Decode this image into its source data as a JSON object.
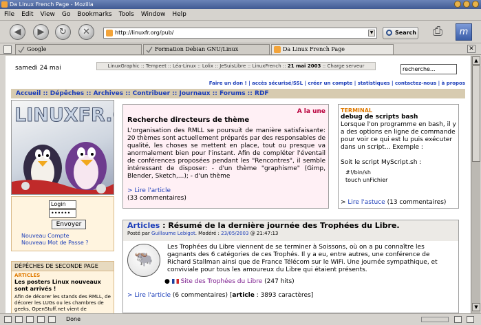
{
  "window": {
    "title": "Da Linux French Page - Mozilla"
  },
  "menu": [
    "File",
    "Edit",
    "View",
    "Go",
    "Bookmarks",
    "Tools",
    "Window",
    "Help"
  ],
  "toolbar": {
    "url": "http://linuxfr.org/pub/",
    "search_label": "Search"
  },
  "tabs": [
    {
      "label": "Google"
    },
    {
      "label": "Formation Debian GNU/Linux"
    },
    {
      "label": "Da Linux French Page"
    }
  ],
  "status": {
    "text": "Done"
  },
  "page": {
    "date": "samedi 24 mai",
    "sites_bar": {
      "before": "LinuxGraphic :: Tempeet :: Léa-Linux :: Lolix :: JeSuisLibre :: LinuxFrench :: ",
      "date": "21 mai 2003",
      "after": " :: Charge serveur"
    },
    "search_value": "recherche...",
    "top_links": "Faire un don ! | accès sécurisé/SSL | créer un compte | statistiques | contactez-nous | à propos",
    "nav": "Accueil :: Dépêches :: Archives :: Contribuer :: Journaux :: Forums :: RDF",
    "logo_text": "LINUXFR.ORG",
    "login": {
      "login_value": "Login",
      "password_value": "••••••",
      "submit": "Envoyer",
      "new_account": "Nouveau Compte",
      "new_password": "Nouveau Mot de Passe ?"
    },
    "second": {
      "header": "DÉPÊCHES DE SECONDE PAGE",
      "category": "ARTICLES",
      "title": "Les posters Linux nouveaux sont arrivés !",
      "text": "Afin de décorer les stands des RMLL, de décorer les LUGs ou les chambres de geeks, OpenStuff.net vient de"
    },
    "une": {
      "label": "A la une",
      "title": "Recherche directeurs de thème",
      "text": "L'organisation des RMLL se poursuit de manière satisfaisante: 20 thèmes sont actuellement préparés par des responsables de qualité, les choses se mettent en place, tout ou presque va anormalement bien pour l'instant. Afin de compléter l'éventail de conférences proposées pendant les \"Rencontres\", il semble intéressant de disposer: - d'un thème \"graphisme\" (Gimp, Blender, Sketch,...); - d'un thème",
      "read_more": "> Lire l'article",
      "comments": "(33 commentaires)"
    },
    "terminal": {
      "category": "TERMINAL",
      "title": "debug de scripts bash",
      "text": "Lorsque l'on programme en bash, il y a des options en ligne de commande pour voir ce qui est lu puis exécuter dans un script... Exemple :",
      "text2": "Soit le script MyScript.sh :",
      "code1": "#!/bin/sh",
      "code2": "touch unFichier",
      "read_prefix": "> ",
      "read_link": "Lire l'astuce",
      "read_suffix": " (13 commentaires)"
    },
    "article": {
      "section": "Articles",
      "title": " : Résumé de la dernière journée des Trophées du Libre.",
      "by_prefix": "Posté par ",
      "author": "Guillaume Lebigot",
      "by_mid": ". Modéré : ",
      "date_link": "23/05/2003",
      "time": " @ 21:47:13",
      "text": "Les Trophées du Libre viennent de se terminer à Soissons, où on a pu connaître les gagnants des 6 catégories de ces Trophés. Il y a eu, entre autres, une conférence de Richard Stallman ainsi que de France Télécom sur le WiFi. Une journée sympathique, et conviviale pour tous les amoureux du Libre qui étaient présents.",
      "link_label": "Site des Trophées du Libre",
      "link_hits": " (247 hits)",
      "read_more": "> Lire l'article",
      "read_comments": " (6 commentaires) [",
      "read_bold": "article",
      "read_chars": " : 3893 caractères]"
    }
  }
}
